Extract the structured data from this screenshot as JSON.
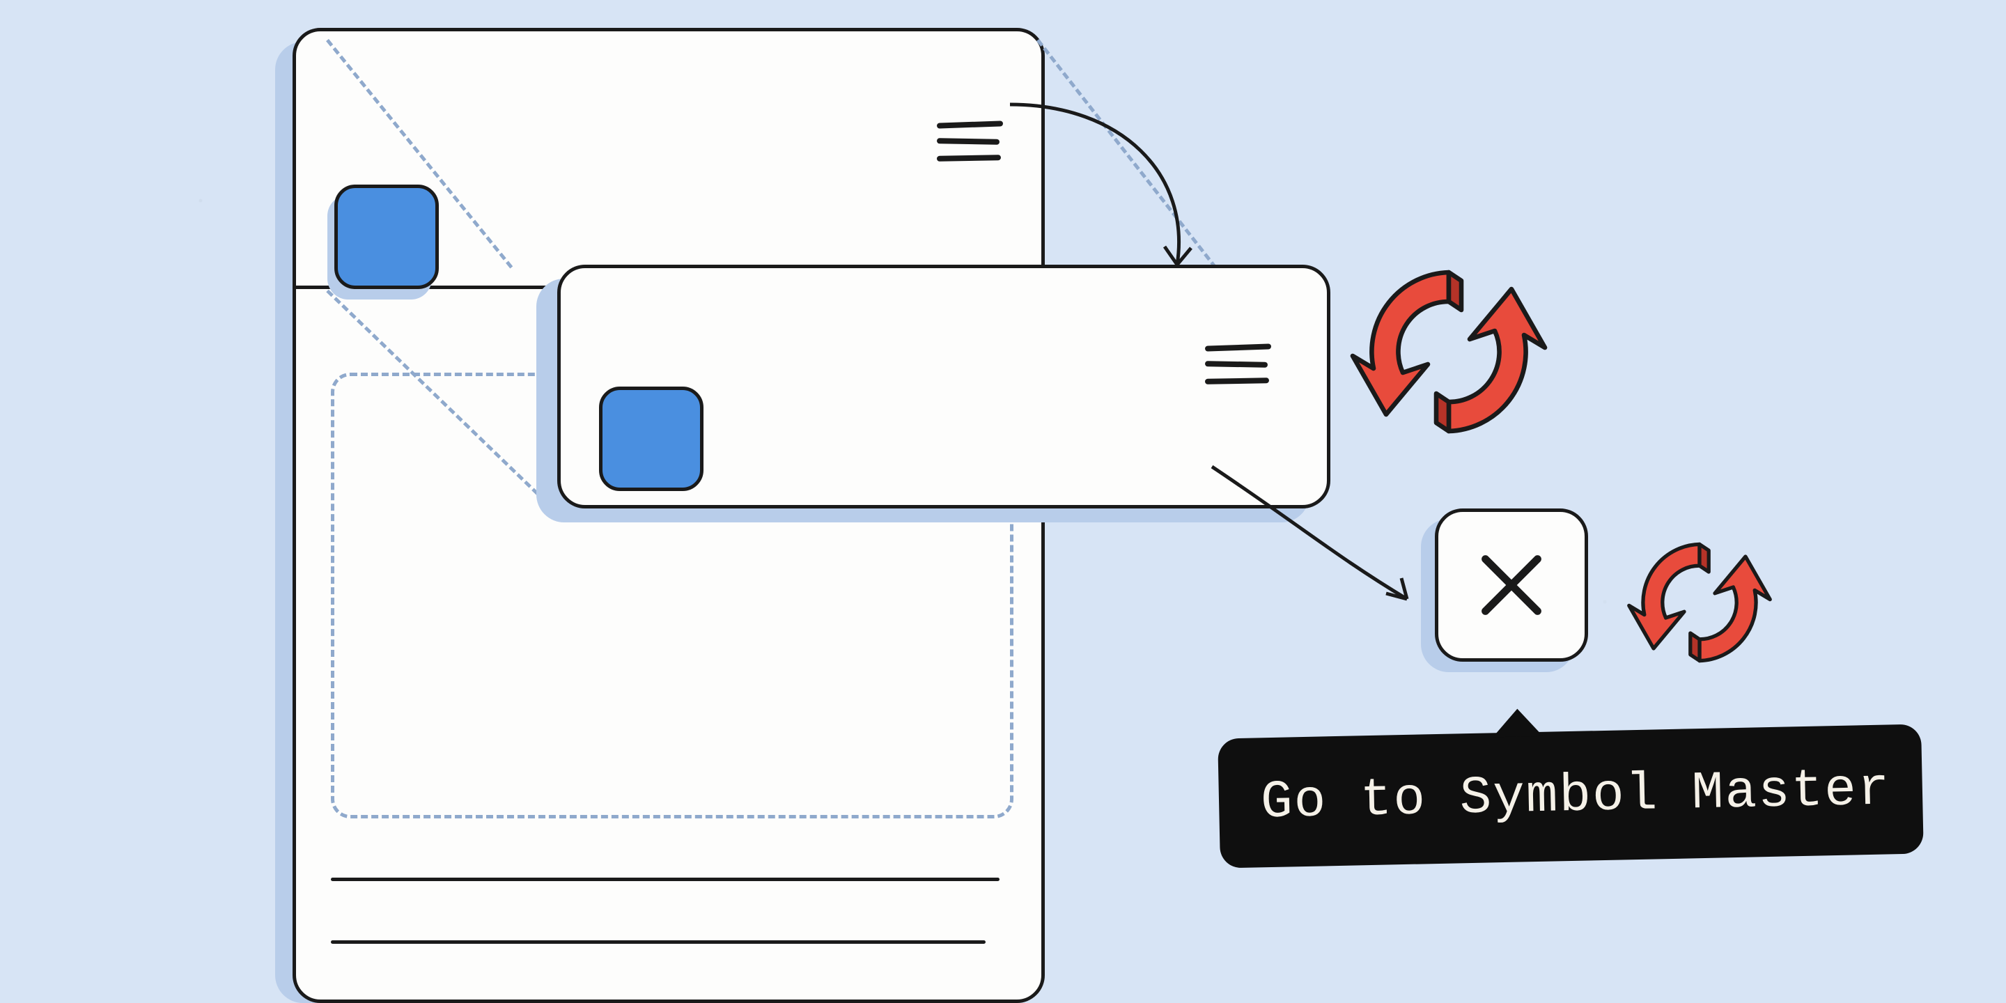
{
  "tooltip": {
    "text": "Go to Symbol Master"
  },
  "icons": {
    "hamburger": "hamburger-icon",
    "thumbnail": "thumbnail-icon",
    "sync_large": "sync-icon",
    "sync_small": "sync-icon",
    "close": "close-icon"
  },
  "colors": {
    "background": "#d7e4f5",
    "panel": "#fdfdfc",
    "shadow": "#b8cdea",
    "stroke": "#1a1a1a",
    "accent_blue": "#4a8fe0",
    "accent_red": "#e84b3c",
    "tooltip_bg": "#0f0f0f",
    "tooltip_text": "#f5f1e8"
  }
}
